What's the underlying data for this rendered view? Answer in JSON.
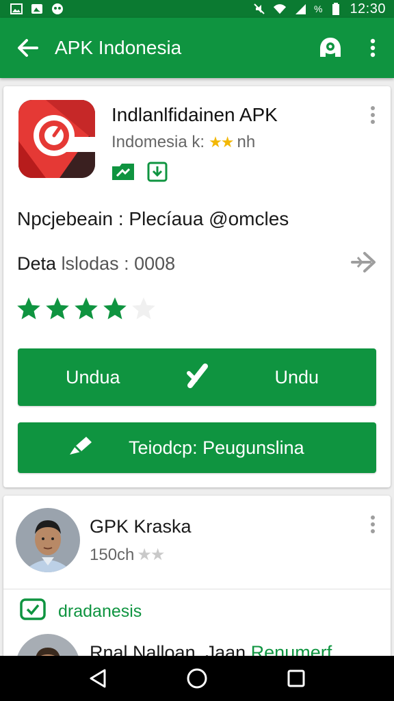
{
  "status_bar": {
    "time": "12:30",
    "battery_text": "%",
    "left_icons": [
      "image-icon",
      "gallery-icon",
      "game-icon"
    ],
    "right_icons": [
      "mute-icon",
      "wifi-icon",
      "signal-icon",
      "battery-icon"
    ]
  },
  "app_bar": {
    "title": "APK Indonesia",
    "actions": [
      "account-icon",
      "more-vert-icon"
    ]
  },
  "app_card": {
    "name": "Indlanlfidainen APK",
    "subtitle": "Indomesia k:",
    "subtitle_suffix": "nh",
    "subtitle_stars": "★★",
    "line1": "Npcjebeain : Plecíaua @omcles",
    "line2_label": "Deta",
    "line2_value": "lslodas : 0008",
    "rating": 4,
    "rating_max": 5,
    "button1_left": "Undua",
    "button1_right": "Undu",
    "button2_label": "Teiodcp: Peugunslina"
  },
  "review_card": {
    "reviewer_name": "GPK Kraska",
    "reviewer_meta": "150ch",
    "reviewer_stars": "★★",
    "section_label": "dradanesis",
    "second_reviewer": "Rnal Nalloan. Jaan",
    "second_reviewer_badge": "Renumerf"
  },
  "colors": {
    "accent": "#0f9440",
    "status_bar": "#0b7a31",
    "app_icon": "#e53935"
  }
}
